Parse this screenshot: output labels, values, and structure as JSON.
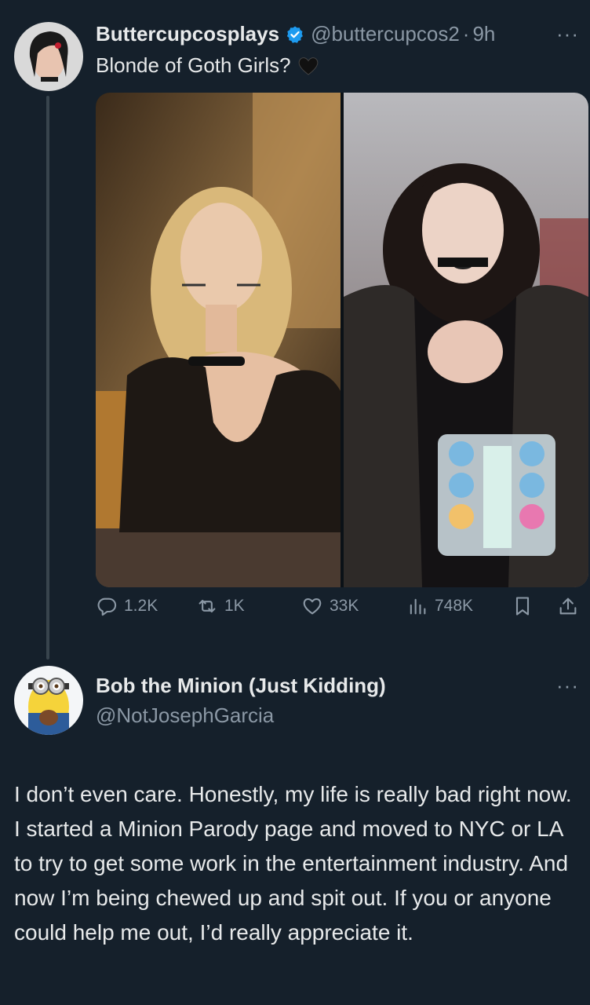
{
  "tweet": {
    "display_name": "Buttercupcosplays",
    "handle": "@buttercupcos2",
    "separator": "·",
    "time": "9h",
    "more_label": "···",
    "text": "Blonde of Goth Girls?",
    "emoji": "black-heart-icon",
    "actions": {
      "replies": "1.2K",
      "reposts": "1K",
      "likes": "33K",
      "views": "748K"
    }
  },
  "reply": {
    "display_name": "Bob the Minion (Just Kidding)",
    "handle": "@NotJosephGarcia",
    "more_label": "···",
    "text": "I don’t even care. Honestly, my life is really bad right now. I started a Minion Parody page and moved to NYC or LA to try to get some work in the entertainment industry. And now I’m being chewed up and spit out. If you or anyone could help me out, I’d really appreciate it."
  },
  "colors": {
    "background": "#15202b",
    "text_primary": "#e7e9ea",
    "text_secondary": "#8b98a5",
    "verified": "#1d9bf0"
  }
}
